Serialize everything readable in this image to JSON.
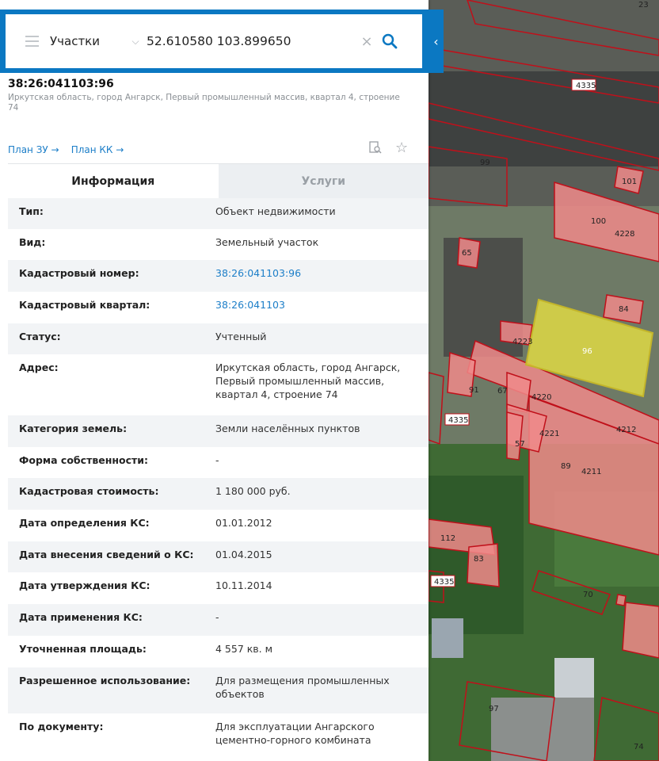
{
  "search": {
    "layer": "Участки",
    "query": "52.610580 103.899650"
  },
  "object": {
    "cad_number": "38:26:041103:96",
    "address_short": "Иркутская область, город Ангарск, Первый промышленный массив, квартал 4, строение 74",
    "links": [
      "План ЗУ →",
      "План КК →"
    ]
  },
  "tabs": [
    "Информация",
    "Услуги"
  ],
  "rows": [
    {
      "key": "Тип:",
      "value": "Объект недвижимости"
    },
    {
      "key": "Вид:",
      "value": "Земельный участок"
    },
    {
      "key": "Кадастровый номер:",
      "value": "38:26:041103:96",
      "link": true
    },
    {
      "key": "Кадастровый квартал:",
      "value": "38:26:041103",
      "link": true
    },
    {
      "key": "Статус:",
      "value": "Учтенный"
    },
    {
      "key": "Адрес:",
      "value": "Иркутская область, город Ангарск, Первый промышленный массив, квартал 4, строение 74"
    },
    {
      "key": "Категория земель:",
      "value": "Земли населённых пунктов"
    },
    {
      "key": "Форма собственности:",
      "value": "-"
    },
    {
      "key": "Кадастровая стоимость:",
      "value": "1 180 000 руб."
    },
    {
      "key": "Дата определения КС:",
      "value": "01.01.2012"
    },
    {
      "key": "Дата внесения сведений о КС:",
      "value": "01.04.2015"
    },
    {
      "key": "Дата утверждения КС:",
      "value": "10.11.2014"
    },
    {
      "key": "Дата применения КС:",
      "value": "-"
    },
    {
      "key": "Уточненная площадь:",
      "value": "4 557 кв. м"
    },
    {
      "key": "Разрешенное использование:",
      "value": "Для размещения промышленных объектов"
    },
    {
      "key": "По документу:",
      "value": "Для эксплуатации Ангарского цементно-горного комбината"
    }
  ],
  "map_labels": [
    "4335",
    "99",
    "101",
    "100",
    "4228",
    "65",
    "84",
    "4223",
    "96",
    "91",
    "67",
    "4220",
    "4335",
    "4221",
    "4212",
    "57",
    "89",
    "4211",
    "112",
    "83",
    "4335",
    "70",
    "97",
    "74",
    "23"
  ],
  "colors": {
    "accent": "#0b78c2",
    "link": "#1c7ec8",
    "selected_parcel": "#e6e042",
    "parcel_fill": "#f08a8a",
    "parcel_stroke": "#c0101a"
  }
}
